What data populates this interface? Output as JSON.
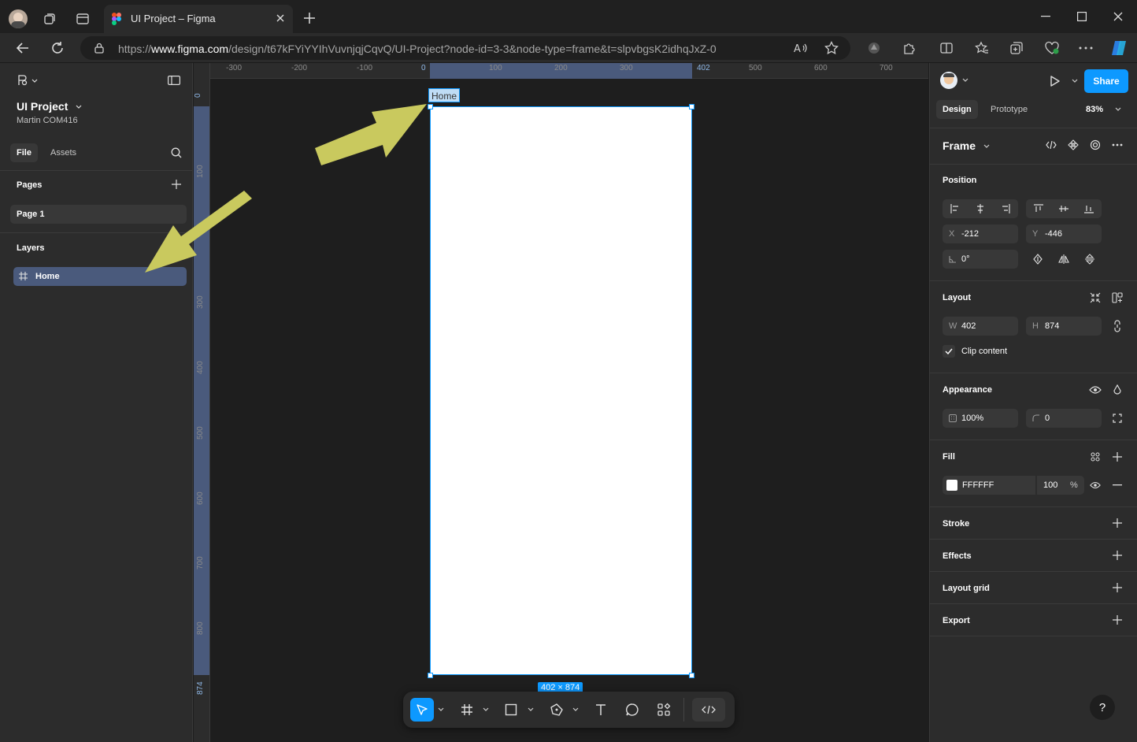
{
  "browser": {
    "tab_title": "UI Project – Figma",
    "url_prefix": "https://",
    "url_host": "www.figma.com",
    "url_path": "/design/t67kFYiYYIhVuvnjqjCqvQ/UI-Project?node-id=3-3&node-type=frame&t=slpvbgsK2idhqJxZ-0"
  },
  "left_panel": {
    "project_name": "UI Project",
    "team_name": "Martin COM416",
    "tab_file": "File",
    "tab_assets": "Assets",
    "pages_heading": "Pages",
    "page_items": [
      "Page 1"
    ],
    "layers_heading": "Layers",
    "layer_items": [
      "Home"
    ]
  },
  "rulers": {
    "horizontal": [
      "-300",
      "-200",
      "-100",
      "0",
      "100",
      "200",
      "300",
      "402",
      "500",
      "600",
      "700"
    ],
    "vertical": [
      "0",
      "100",
      "300",
      "400",
      "500",
      "600",
      "700",
      "800",
      "874"
    ]
  },
  "canvas": {
    "frame_label": "Home",
    "frame_dims": "402 × 874",
    "frame_fill": "#ffffff",
    "selection_color": "#0d99ff"
  },
  "right_panel": {
    "share_label": "Share",
    "tab_design": "Design",
    "tab_prototype": "Prototype",
    "zoom": "83%",
    "frame_type": "Frame",
    "position_heading": "Position",
    "x_label": "X",
    "x_value": "-212",
    "y_label": "Y",
    "y_value": "-446",
    "rotation": "0°",
    "layout_heading": "Layout",
    "w_label": "W",
    "w_value": "402",
    "h_label": "H",
    "h_value": "874",
    "clip_content": "Clip content",
    "appearance_heading": "Appearance",
    "opacity": "100%",
    "radius": "0",
    "fill_heading": "Fill",
    "fill_hex": "FFFFFF",
    "fill_opacity": "100",
    "fill_pct": "%",
    "stroke_heading": "Stroke",
    "effects_heading": "Effects",
    "layout_grid_heading": "Layout grid",
    "export_heading": "Export",
    "help": "?"
  },
  "colors": {
    "accent": "#0d99ff",
    "annotation_arrow": "#c9c95e",
    "layer_selected": "#4a5a7c"
  }
}
